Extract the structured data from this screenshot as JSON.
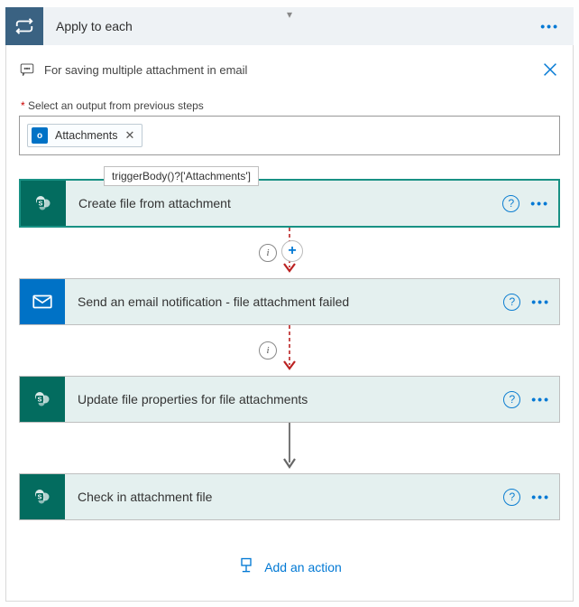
{
  "header": {
    "title": "Apply to each",
    "comment": "For saving multiple attachment in email"
  },
  "input_select": {
    "label": "Select an output from previous steps",
    "chip_text": "Attachments"
  },
  "tooltip": "triggerBody()?['Attachments']",
  "cards": {
    "create": "Create file from attachment",
    "email": "Send an email notification - file attachment failed",
    "update": "Update file properties for file attachments",
    "checkin": "Check in attachment file"
  },
  "footer": {
    "add_action": "Add an action"
  }
}
